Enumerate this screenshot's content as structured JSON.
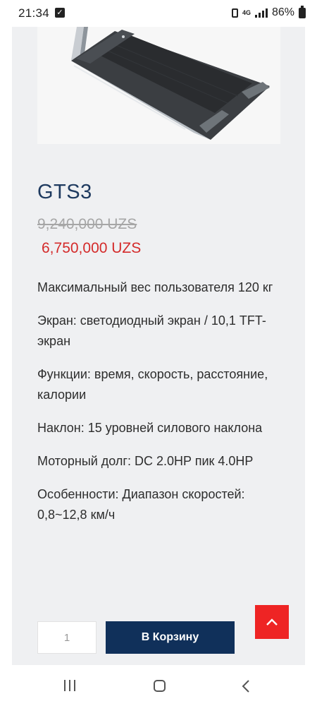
{
  "status_bar": {
    "time": "21:34",
    "network": "4G",
    "battery_percent": "86%"
  },
  "product": {
    "title": "GTS3",
    "old_price": "9,240,000 UZS",
    "new_price": "6,750,000 UZS",
    "specs": [
      "Максимальный вес пользователя 120 кг",
      "Экран: светодиодный экран / 10,1 TFT-экран",
      "Функции: время, скорость, расстояние, калории",
      "Наклон: 15 уровней силового наклона",
      "Моторный долг: DC 2.0HP пик 4.0HP",
      "Особенности: Диапазон скоростей: 0,8~12,8 км/ч"
    ]
  },
  "cart": {
    "quantity": "1",
    "add_to_cart_label": "В Корзину"
  },
  "colors": {
    "title": "#1e3a5f",
    "sale_price": "#d42a2a",
    "cart_button": "#10305a",
    "scroll_top_button": "#ee2424"
  },
  "icons": {
    "scroll_top": "chevron-up-icon",
    "nav_recent": "recent-apps-icon",
    "nav_home": "home-icon",
    "nav_back": "back-icon"
  }
}
